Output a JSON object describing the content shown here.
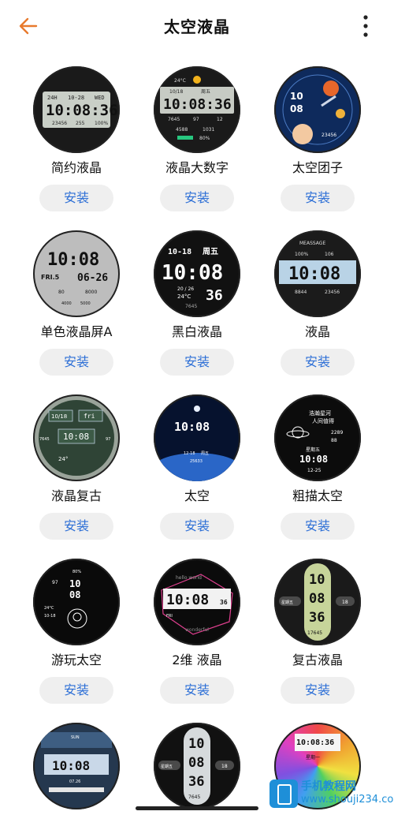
{
  "header": {
    "title": "太空液晶",
    "back_icon": "back-arrow-icon",
    "more_icon": "more-vertical-icon",
    "accent": "#e87a2d"
  },
  "install_color": "#2d6fd6",
  "faces": [
    {
      "name": "简约液晶",
      "install": "安装",
      "lcd": [
        "24H",
        "10-28",
        "WED",
        "10:08:36",
        "23456",
        "255",
        "100%"
      ]
    },
    {
      "name": "液晶大数字",
      "install": "安装",
      "lcd": [
        "24°C",
        "10/18",
        "周五",
        "10:08:36",
        "7645",
        "97",
        "12",
        "4588",
        "1031",
        "80%"
      ]
    },
    {
      "name": "太空团子",
      "install": "安装",
      "lcd": [
        "10",
        "08",
        "23456"
      ]
    },
    {
      "name": "单色液晶屏A",
      "install": "安装",
      "lcd": [
        "10:08",
        "FRI.5",
        "06-26",
        "80",
        "8000",
        "4000",
        "5000"
      ]
    },
    {
      "name": "黑白液晶",
      "install": "安装",
      "lcd": [
        "10-18",
        "周五",
        "10:08",
        "20 / 26",
        "24°C",
        "36",
        "7645"
      ]
    },
    {
      "name": "液晶",
      "install": "安装",
      "lcd": [
        "MEASSAGE",
        "100%",
        "106",
        "10:08",
        "8844",
        "23456"
      ]
    },
    {
      "name": "液晶复古",
      "install": "安装",
      "lcd": [
        "10/18",
        "fri",
        "7645",
        "97",
        "10:08",
        "24°"
      ]
    },
    {
      "name": "太空",
      "install": "安装",
      "lcd": [
        "10:08",
        "12-18",
        "周五",
        "25633"
      ]
    },
    {
      "name": "粗描太空",
      "install": "安装",
      "lcd": [
        "浩瀚星河",
        "人间值得",
        "2289",
        "88",
        "星期五",
        "10:08",
        "12-25"
      ]
    },
    {
      "name": "游玩太空",
      "install": "安装",
      "lcd": [
        "80%",
        "97",
        "10",
        "08",
        "24°C",
        "10-18"
      ]
    },
    {
      "name": "2维 液晶",
      "install": "安装",
      "lcd": [
        "hello world",
        "10:08",
        "36",
        "FRI",
        "wonderful"
      ]
    },
    {
      "name": "复古液晶",
      "install": "安装",
      "lcd": [
        "10",
        "08",
        "36",
        "星期五",
        "18",
        "17645"
      ]
    },
    {
      "name": "",
      "install": "",
      "lcd": [
        "SUN",
        "10:08",
        "07.26"
      ]
    },
    {
      "name": "",
      "install": "",
      "lcd": [
        "10",
        "08",
        "36",
        "星期五",
        "18",
        "7645"
      ]
    },
    {
      "name": "",
      "install": "",
      "lcd": [
        "10:08:36",
        "星期一"
      ]
    }
  ],
  "watermark": {
    "line1": "手机教程网",
    "line2": "www.shouji234.com"
  }
}
